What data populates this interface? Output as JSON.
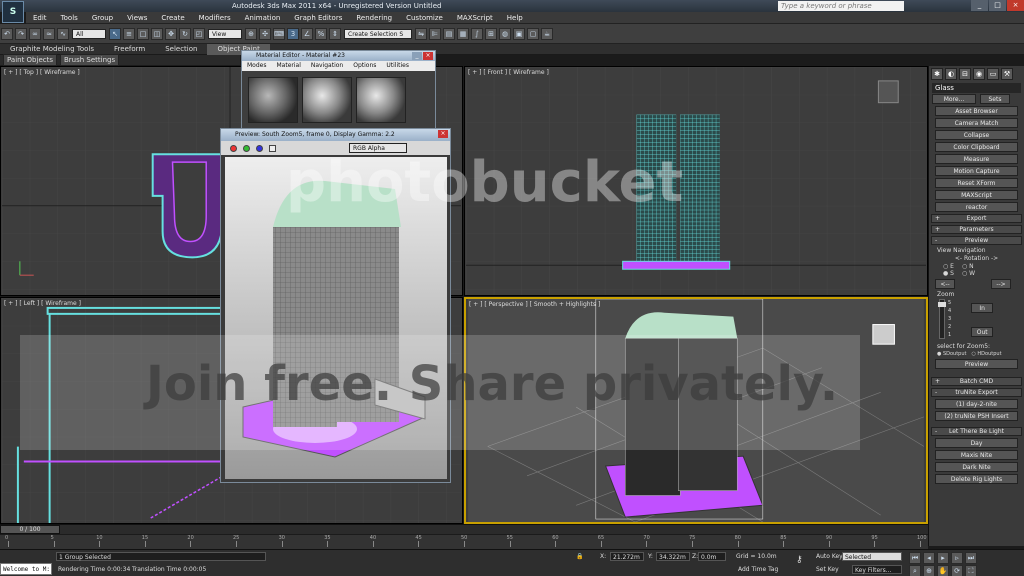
{
  "app": {
    "title": "Autodesk 3ds Max 2011 x64  -  Unregistered Version   Untitled",
    "logo_text": "S",
    "search_placeholder": "Type a keyword or phrase",
    "win_min": "_",
    "win_max": "□",
    "win_close": "×"
  },
  "menu": [
    "Edit",
    "Tools",
    "Group",
    "Views",
    "Create",
    "Modifiers",
    "Animation",
    "Graph Editors",
    "Rendering",
    "Customize",
    "MAXScript",
    "Help"
  ],
  "toolbar": {
    "filter_value": "All",
    "view_value": "View",
    "selection_set_value": "Create Selection S"
  },
  "ribbon": {
    "tabs": [
      "Graphite Modeling Tools",
      "Freeform",
      "Selection",
      "Object Paint"
    ],
    "sub_tabs": [
      "Paint Objects",
      "Brush Settings"
    ]
  },
  "viewports": {
    "top": "[ + ] [ Top ] [ Wireframe ]",
    "front": "[ + ] [ Front ] [ Wireframe ]",
    "left": "[ + ] [ Left ] [ Wireframe ]",
    "persp": "[ + ] [ Perspective ] [ Smooth + Highlights ]"
  },
  "material_editor": {
    "title": "Material Editor - Material #23",
    "menu": [
      "Modes",
      "Material",
      "Navigation",
      "Options",
      "Utilities"
    ]
  },
  "preview_window": {
    "title": "Preview: South Zoom5, frame 0, Display Gamma: 2.2",
    "channel": "RGB Alpha"
  },
  "command_panel": {
    "object_name": "Glass",
    "more_label": "More...",
    "sets_label": "Sets",
    "buttons": [
      "Asset Browser",
      "Camera Match",
      "Collapse",
      "Color Clipboard",
      "Measure",
      "Motion Capture",
      "Reset XForm",
      "MAXScript",
      "reactor"
    ],
    "rollouts": {
      "export": "Export",
      "parameters": "Parameters",
      "preview": "Preview",
      "batch": "Batch CMD",
      "trunite": "truNite Export",
      "light": "Let There Be Light"
    },
    "view_navigation": "View Navigation",
    "rotation": "<- Rotation ->",
    "dir_e": "E",
    "dir_n": "N",
    "dir_s": "S",
    "dir_w": "W",
    "zoom_label": "Zoom",
    "zoom_levels": [
      "5",
      "4",
      "3",
      "2",
      "1"
    ],
    "in_label": "In",
    "out_label": "Out",
    "select_for": "select for Zoom5:",
    "sd_output": "SDoutput",
    "hd_output": "HDoutput",
    "preview_btn": "Preview",
    "trunite_btns": [
      "(1) day-2-nite",
      "(2) truNite PSH Insert"
    ],
    "light_btns": [
      "Day",
      "Maxis Nite",
      "Dark Nite",
      "Delete Rig Lights"
    ]
  },
  "timeline": {
    "slider": "0 / 100",
    "ruler": [
      "0",
      "5",
      "10",
      "15",
      "20",
      "25",
      "30",
      "35",
      "40",
      "45",
      "50",
      "55",
      "60",
      "65",
      "70",
      "75",
      "80",
      "85",
      "90",
      "95",
      "100"
    ]
  },
  "status": {
    "selection": "1 Group Selected",
    "render_time": "Rendering Time  0:00:34",
    "translation_time": "Translation Time  0:00:05",
    "x_label": "X:",
    "x_value": "21.272m",
    "y_label": "Y:",
    "y_value": "34.322m",
    "z_label": "Z:",
    "z_value": "0.0m",
    "grid": "Grid = 10.0m",
    "add_time_tag": "Add Time Tag",
    "auto_key": "Auto Key",
    "auto_key_value": "Selected",
    "set_key": "Set Key",
    "key_filters": "Key Filters...",
    "dock": "Welcome to M:"
  },
  "watermark": {
    "brand": "photobucket",
    "slogan": "Join free. Share privately."
  },
  "colors": {
    "accent_yellow": "#c8a000",
    "tower_cyan": "#66e0e0",
    "podium_magenta": "#c050ff",
    "roof_mint": "#b8e0c8"
  }
}
